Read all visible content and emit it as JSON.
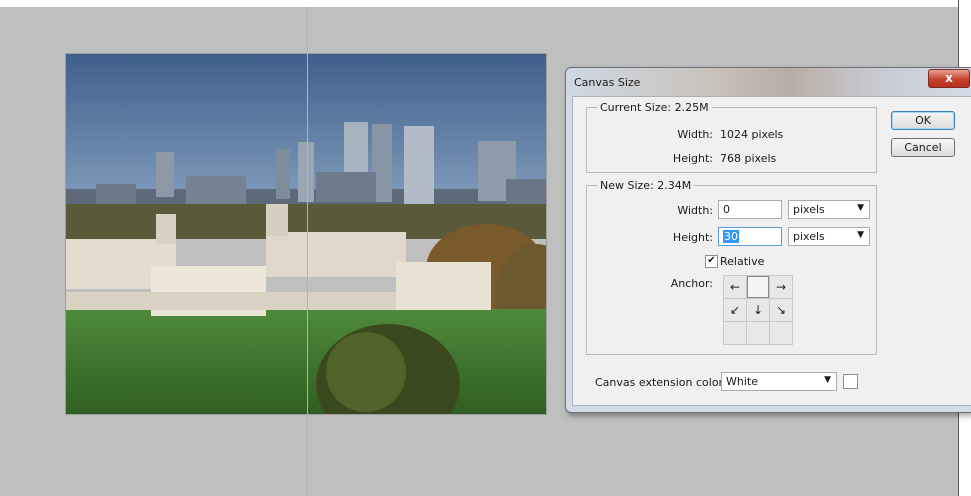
{
  "dialog": {
    "title": "Canvas Size",
    "close_label": "x",
    "ok_label": "OK",
    "cancel_label": "Cancel",
    "current": {
      "legend": "Current Size: 2.25M",
      "width_label": "Width:",
      "width_value": "1024 pixels",
      "height_label": "Height:",
      "height_value": "768 pixels"
    },
    "new": {
      "legend": "New Size: 2.34M",
      "width_label": "Width:",
      "width_value": "0",
      "width_unit": "pixels",
      "height_label": "Height:",
      "height_value": "30",
      "height_unit": "pixels",
      "relative_label": "Relative",
      "relative_checked": true,
      "anchor_label": "Anchor:",
      "anchor_arrows": [
        "←",
        "",
        "→",
        "↙",
        "↓",
        "↘",
        "",
        "",
        ""
      ]
    },
    "extension": {
      "label": "Canvas extension color:",
      "value": "White"
    }
  },
  "colors": {
    "workspace": "#bfbfbf",
    "guide": "#5fd6d8",
    "selection": "#3399ff"
  }
}
